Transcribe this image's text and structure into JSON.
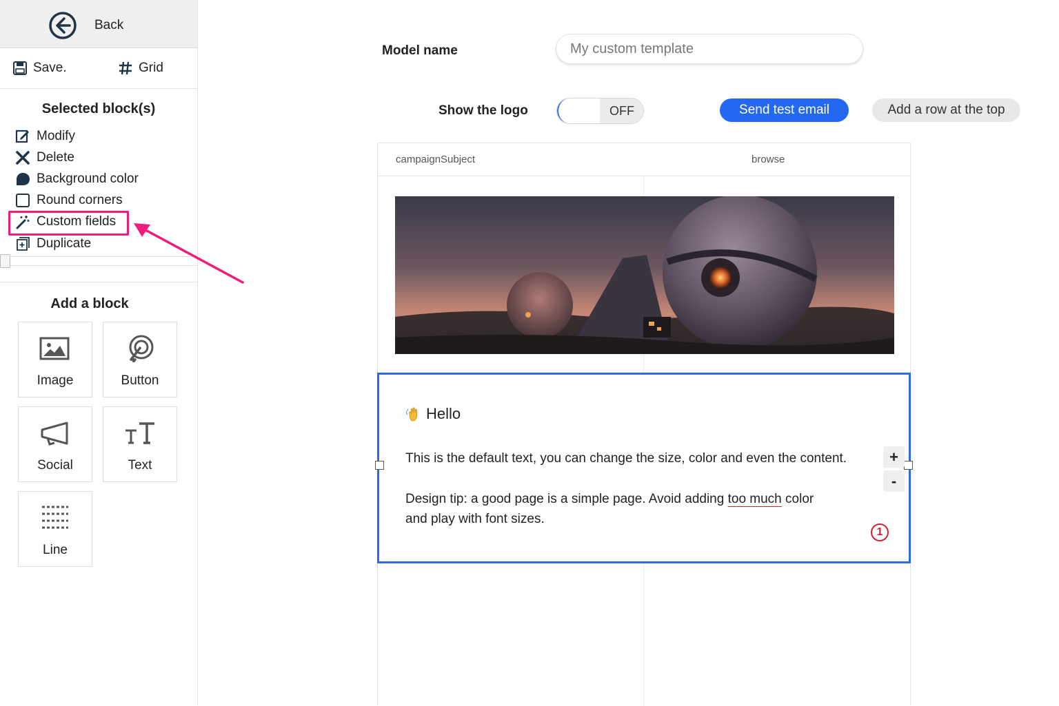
{
  "sidebar": {
    "back_label": "Back",
    "save_label": "Save.",
    "grid_label": "Grid",
    "selected_title": "Selected block(s)",
    "items": [
      {
        "label": "Modify"
      },
      {
        "label": "Delete"
      },
      {
        "label": "Background color"
      },
      {
        "label": "Round corners"
      },
      {
        "label": "Custom fields"
      },
      {
        "label": "Duplicate"
      }
    ],
    "add_title": "Add a block",
    "blocks": [
      {
        "label": "Image"
      },
      {
        "label": "Button"
      },
      {
        "label": "Social"
      },
      {
        "label": "Text"
      },
      {
        "label": "Line"
      }
    ]
  },
  "main": {
    "model_name_label": "Model name",
    "model_name_value": "My custom template",
    "show_logo_label": "Show the logo",
    "toggle_state": "OFF",
    "send_test_label": "Send test email",
    "add_row_label": "Add a row at the top",
    "header_left": "campaignSubject",
    "header_right": "browse",
    "hello": "Hello",
    "para1": "This is the default text, you can change the size, color and even the content.",
    "para2_a": "Design tip: a good page is a simple page. Avoid adding ",
    "para2_b": "too much",
    "para2_c": " color",
    "para2_d": "and play with font sizes.",
    "plus_label": "+",
    "minus_label": "-",
    "badge": "1"
  },
  "colors": {
    "accent_blue": "#2468f2",
    "highlight_pink": "#ef1c7a",
    "badge_red": "#d4212c"
  }
}
